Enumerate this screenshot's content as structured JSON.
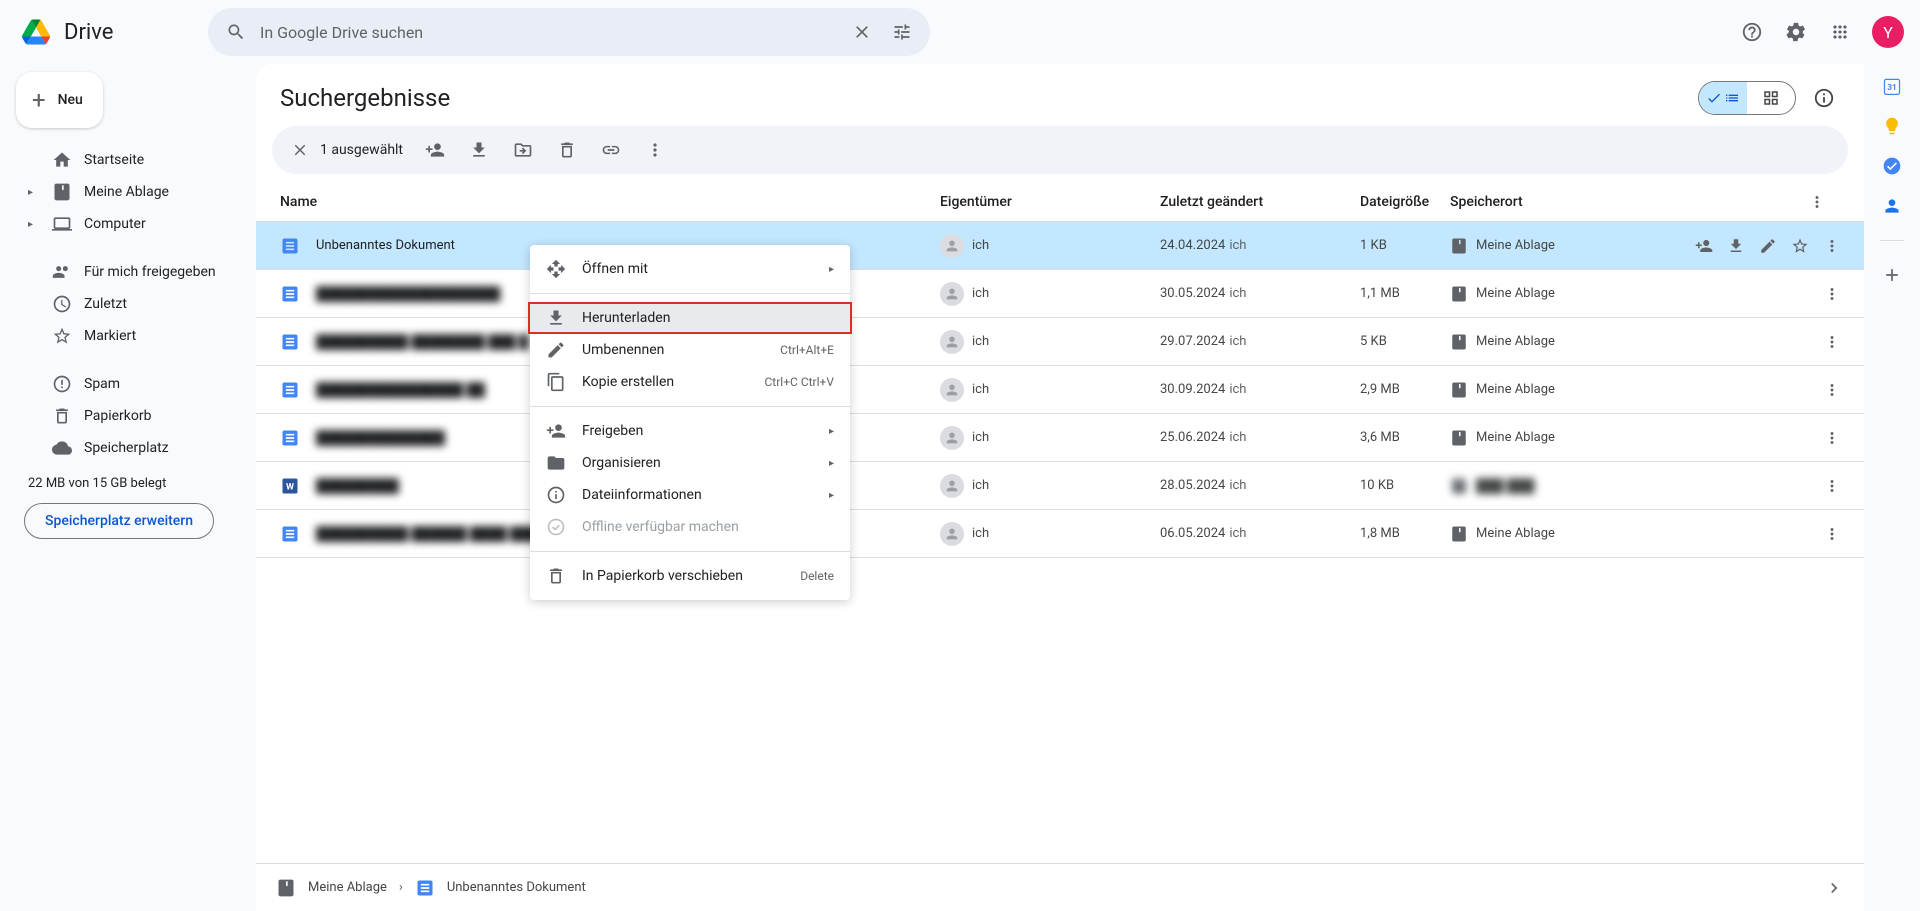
{
  "header": {
    "drive_text": "Drive",
    "search_placeholder": "In Google Drive suchen",
    "avatar_letter": "Y"
  },
  "sidebar": {
    "new_label": "Neu",
    "items": [
      {
        "label": "Startseite",
        "icon": "home"
      },
      {
        "label": "Meine Ablage",
        "icon": "drive",
        "expandable": true
      },
      {
        "label": "Computer",
        "icon": "computer",
        "expandable": true
      }
    ],
    "items2": [
      {
        "label": "Für mich freigegeben",
        "icon": "shared"
      },
      {
        "label": "Zuletzt",
        "icon": "clock"
      },
      {
        "label": "Markiert",
        "icon": "star"
      }
    ],
    "items3": [
      {
        "label": "Spam",
        "icon": "spam"
      },
      {
        "label": "Papierkorb",
        "icon": "trash"
      },
      {
        "label": "Speicherplatz",
        "icon": "cloud"
      }
    ],
    "storage_text": "22 MB von 15 GB belegt",
    "storage_btn": "Speicherplatz erweitern"
  },
  "main": {
    "title": "Suchergebnisse",
    "selection_text": "1 ausgewählt",
    "columns": {
      "name": "Name",
      "owner": "Eigentümer",
      "modified": "Zuletzt geändert",
      "size": "Dateigröße",
      "location": "Speicherort"
    },
    "rows": [
      {
        "name": "Unbenanntes Dokument",
        "owner": "ich",
        "date": "24.04.2024",
        "mod_by": "ich",
        "size": "1 KB",
        "location": "Meine Ablage",
        "type": "doc",
        "selected": true,
        "blurred": false
      },
      {
        "name": "████████████████████",
        "owner": "ich",
        "date": "30.05.2024",
        "mod_by": "ich",
        "size": "1,1 MB",
        "location": "Meine Ablage",
        "type": "doc",
        "blurred": true
      },
      {
        "name": "██████████ ████████ ███ █",
        "owner": "ich",
        "date": "29.07.2024",
        "mod_by": "ich",
        "size": "5 KB",
        "location": "Meine Ablage",
        "type": "doc",
        "blurred": true
      },
      {
        "name": "████████████████ ██",
        "owner": "ich",
        "date": "30.09.2024",
        "mod_by": "ich",
        "size": "2,9 MB",
        "location": "Meine Ablage",
        "type": "doc",
        "blurred": true
      },
      {
        "name": "██████████████",
        "owner": "ich",
        "date": "25.06.2024",
        "mod_by": "ich",
        "size": "3,6 MB",
        "location": "Meine Ablage",
        "type": "doc",
        "blurred": true
      },
      {
        "name": "█████████",
        "owner": "ich",
        "date": "28.05.2024",
        "mod_by": "ich",
        "size": "10 KB",
        "location": "███ ███",
        "type": "word",
        "blurred": true,
        "loc_blurred": true
      },
      {
        "name": "██████████ ██████ ████ ██████",
        "owner": "ich",
        "date": "06.05.2024",
        "mod_by": "ich",
        "size": "1,8 MB",
        "location": "Meine Ablage",
        "type": "doc",
        "blurred": true
      }
    ]
  },
  "context_menu": {
    "items": [
      {
        "label": "Öffnen mit",
        "icon": "open",
        "submenu": true
      },
      {
        "divider": true
      },
      {
        "label": "Herunterladen",
        "icon": "download",
        "highlighted": true
      },
      {
        "label": "Umbenennen",
        "icon": "rename",
        "shortcut": "Ctrl+Alt+E"
      },
      {
        "label": "Kopie erstellen",
        "icon": "copy",
        "shortcut": "Ctrl+C Ctrl+V"
      },
      {
        "divider": true
      },
      {
        "label": "Freigeben",
        "icon": "share",
        "submenu": true
      },
      {
        "label": "Organisieren",
        "icon": "folder",
        "submenu": true
      },
      {
        "label": "Dateiinformationen",
        "icon": "info",
        "submenu": true
      },
      {
        "label": "Offline verfügbar machen",
        "icon": "offline",
        "disabled": true
      },
      {
        "divider": true
      },
      {
        "label": "In Papierkorb verschieben",
        "icon": "trash",
        "shortcut": "Delete"
      }
    ]
  },
  "bottom_bar": {
    "crumb1": "Meine Ablage",
    "crumb2": "Unbenanntes Dokument"
  }
}
